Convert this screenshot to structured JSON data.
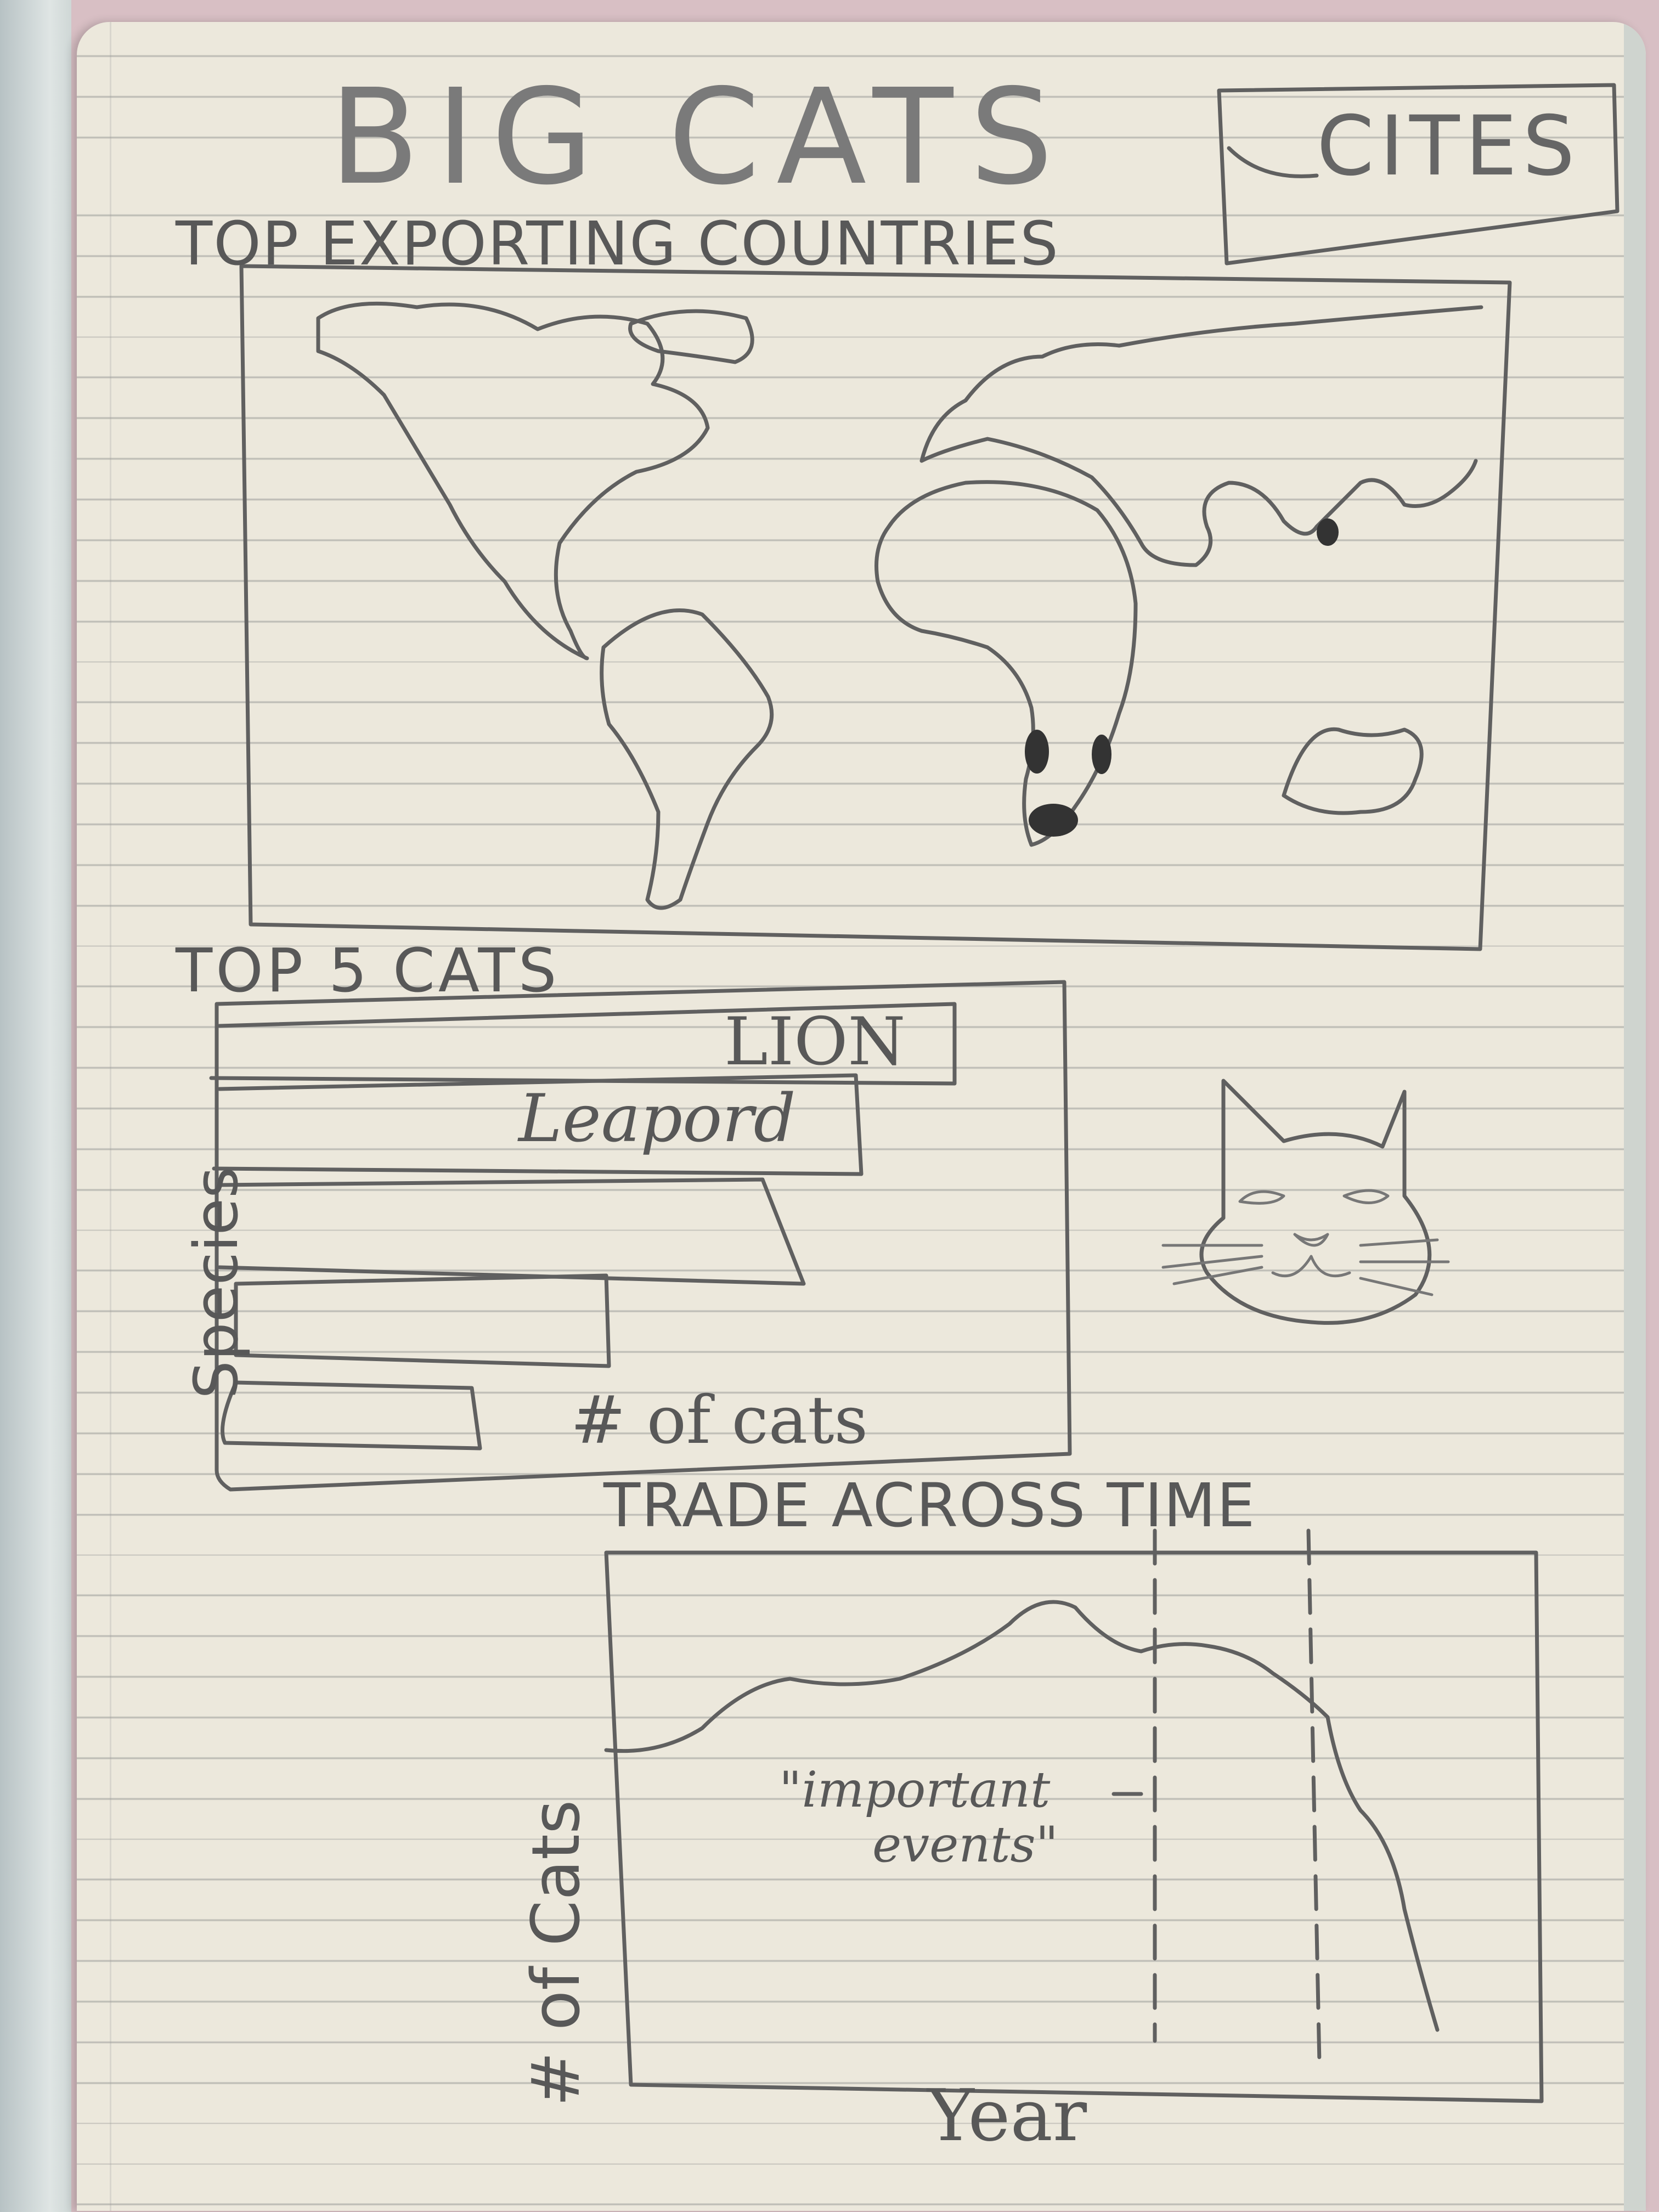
{
  "title": "BIG CATS",
  "badge": "CITES",
  "map_section": {
    "title": "TOP EXPORTING COUNTRIES"
  },
  "bar_section": {
    "title": "TOP 5 CATS",
    "y_axis_label": "Species",
    "x_axis_label": "# of cats",
    "bar_labels": [
      "LION",
      "Leapord"
    ]
  },
  "time_section": {
    "title": "TRADE ACROSS TIME",
    "y_axis_label": "# of Cats",
    "x_axis_label": "Year",
    "annotation_line1": "\"important",
    "annotation_line2": "events\""
  }
}
